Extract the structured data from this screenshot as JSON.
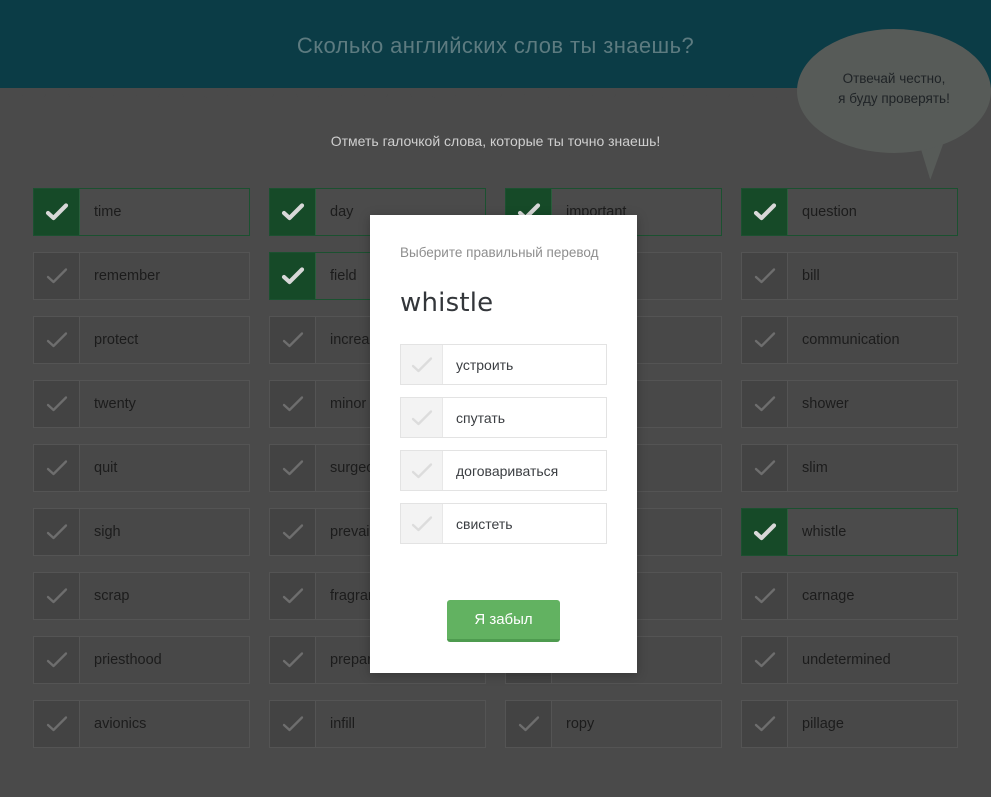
{
  "header": {
    "title": "Сколько английских слов ты знаешь?",
    "bg_color": "#0b3c46",
    "title_color": "#5d7b80"
  },
  "bubble": {
    "line1": "Отвечай честно,",
    "line2": "я буду проверять!",
    "bg_color": "#575b58"
  },
  "instruction": {
    "text": "Отметь галочкой слова, которые ты точно знаешь!"
  },
  "colors": {
    "page_bg": "#4a4a4a",
    "checked_bg": "#1c4d2c",
    "checked_border": "#1b5130",
    "accent_green": "#62b261"
  },
  "columns": [
    {
      "items": [
        {
          "word": "time",
          "checked": true
        },
        {
          "word": "remember",
          "checked": false
        },
        {
          "word": "protect",
          "checked": false
        },
        {
          "word": "twenty",
          "checked": false
        },
        {
          "word": "quit",
          "checked": false
        },
        {
          "word": "sigh",
          "checked": false
        },
        {
          "word": "scrap",
          "checked": false
        },
        {
          "word": "priesthood",
          "checked": false
        },
        {
          "word": "avionics",
          "checked": false
        }
      ]
    },
    {
      "items": [
        {
          "word": "day",
          "checked": true
        },
        {
          "word": "field",
          "checked": true
        },
        {
          "word": "increase",
          "checked": false
        },
        {
          "word": "minor",
          "checked": false
        },
        {
          "word": "surgeon",
          "checked": false
        },
        {
          "word": "prevail",
          "checked": false
        },
        {
          "word": "fragrant",
          "checked": false
        },
        {
          "word": "prepare",
          "checked": false
        },
        {
          "word": "infill",
          "checked": false
        }
      ]
    },
    {
      "items": [
        {
          "word": "important",
          "checked": true
        },
        {
          "word": "",
          "checked": false
        },
        {
          "word": "",
          "checked": false
        },
        {
          "word": "",
          "checked": false
        },
        {
          "word": "",
          "checked": false
        },
        {
          "word": "",
          "checked": false
        },
        {
          "word": "",
          "checked": false
        },
        {
          "word": "",
          "checked": false
        },
        {
          "word": "ropy",
          "checked": false
        }
      ]
    },
    {
      "items": [
        {
          "word": "question",
          "checked": true
        },
        {
          "word": "bill",
          "checked": false
        },
        {
          "word": "communication",
          "checked": false
        },
        {
          "word": "shower",
          "checked": false
        },
        {
          "word": "slim",
          "checked": false
        },
        {
          "word": "whistle",
          "checked": true
        },
        {
          "word": "carnage",
          "checked": false
        },
        {
          "word": "undetermined",
          "checked": false
        },
        {
          "word": "pillage",
          "checked": false
        }
      ]
    }
  ],
  "modal": {
    "prompt": "Выберите правильный перевод",
    "word": "whistle",
    "options": [
      {
        "label": "устроить"
      },
      {
        "label": "спутать"
      },
      {
        "label": "договариваться"
      },
      {
        "label": "свистеть"
      }
    ],
    "forgot_button": "Я забыл"
  }
}
